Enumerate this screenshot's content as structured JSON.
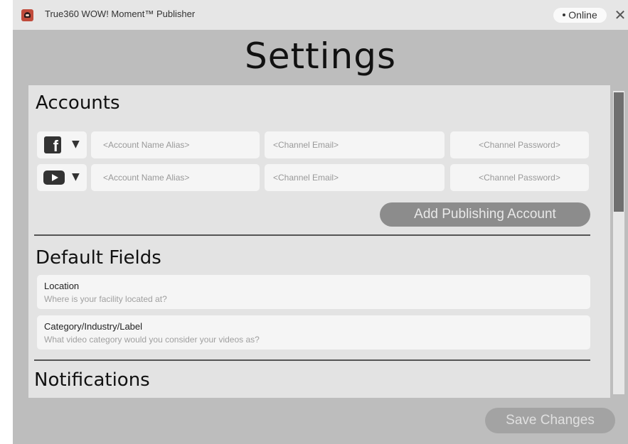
{
  "window": {
    "title": "True360 WOW! Moment™ Publisher",
    "status": "Online",
    "close_glyph": "✕"
  },
  "page": {
    "title": "Settings"
  },
  "accounts": {
    "heading": "Accounts",
    "rows": [
      {
        "platform": "facebook",
        "platform_icon_glyph": "f",
        "alias_placeholder": "<Account Name Alias>",
        "email_placeholder": "<Channel Email>",
        "password_placeholder": "<Channel Password>"
      },
      {
        "platform": "youtube",
        "alias_placeholder": "<Account Name Alias>",
        "email_placeholder": "<Channel Email>",
        "password_placeholder": "<Channel Password>"
      }
    ],
    "caret_glyph": "▼",
    "add_button_label": "Add Publishing Account"
  },
  "default_fields": {
    "heading": "Default Fields",
    "fields": [
      {
        "label": "Location",
        "placeholder": "Where is your facility located at?"
      },
      {
        "label": "Category/Industry/Label",
        "placeholder": "What video category would you consider your videos as?"
      }
    ]
  },
  "notifications": {
    "heading": "Notifications"
  },
  "footer": {
    "save_label": "Save Changes"
  }
}
